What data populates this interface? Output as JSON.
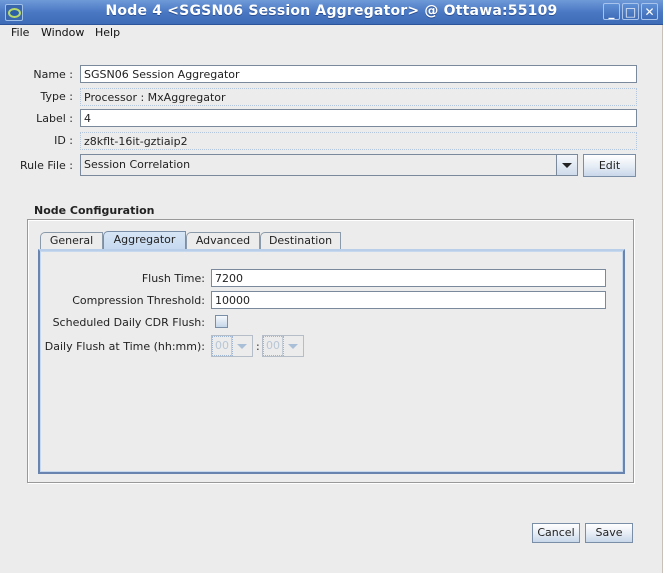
{
  "window": {
    "title": "Node 4 <SGSN06 Session Aggregator> @ Ottawa:55109",
    "controls": {
      "minimize": "_",
      "maximize": "□",
      "close": "✕"
    }
  },
  "menu": [
    "File",
    "Window",
    "Help"
  ],
  "form": {
    "name_label": "Name :",
    "name_value": "SGSN06 Session Aggregator",
    "type_label": "Type :",
    "type_value": "Processor : MxAggregator",
    "label_label": "Label :",
    "label_value": "4",
    "id_label": "ID :",
    "id_value": "z8kflt-16it-gztiaip2",
    "rule_file_label": "Rule File :",
    "rule_file_value": "Session Correlation",
    "edit_button": "Edit"
  },
  "node_configuration": {
    "title": "Node Configuration",
    "tabs": [
      {
        "label": "General",
        "active": false
      },
      {
        "label": "Aggregator",
        "active": true
      },
      {
        "label": "Advanced",
        "active": false
      },
      {
        "label": "Destination",
        "active": false
      }
    ],
    "aggregator": {
      "flush_time_label": "Flush Time:",
      "flush_time_value": "7200",
      "compression_label": "Compression Threshold:",
      "compression_value": "10000",
      "scheduled_label": "Scheduled Daily CDR Flush:",
      "scheduled_checked": false,
      "daily_flush_label": "Daily Flush at Time (hh:mm):",
      "hour_value": "00",
      "minute_value": "00",
      "separator": ":"
    }
  },
  "footer": {
    "cancel": "Cancel",
    "save": "Save"
  }
}
